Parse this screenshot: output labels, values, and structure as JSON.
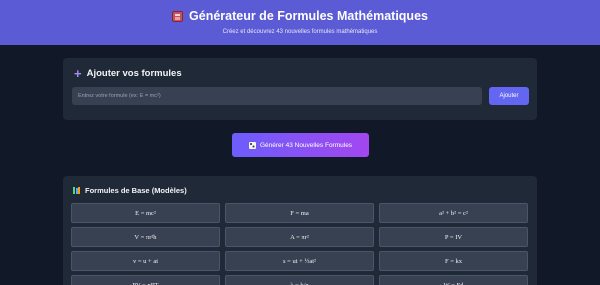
{
  "header": {
    "title": "Générateur de Formules Mathématiques",
    "subtitle": "Créez et découvrez 43 nouvelles formules mathématiques"
  },
  "add_panel": {
    "title": "Ajouter vos formules",
    "input_placeholder": "Entrez votre formule (ex: E = mc²)",
    "input_value": "",
    "add_label": "Ajouter"
  },
  "generate": {
    "label": "Générer 43 Nouvelles Formules"
  },
  "base_panel": {
    "title": "Formules de Base (Modèles)",
    "formulas": [
      "E = mc²",
      "F = ma",
      "a² + b² = c²",
      "V = πr²h",
      "A = πr²",
      "P = IV",
      "v = u + at",
      "s = ut + ½at²",
      "F = kx",
      "PV = nRT",
      "λ = h/p",
      "W = Fd"
    ]
  },
  "colors": {
    "header_bg": "#5b5bd6",
    "page_bg": "#111827",
    "panel_bg": "#1f2937",
    "accent": "#6366f1",
    "gradient_start": "#6d5dfc",
    "gradient_end": "#a347f0"
  },
  "icons": {
    "header": "abacus-icon",
    "add": "plus-icon",
    "generate": "dice-icon",
    "base": "books-icon"
  }
}
